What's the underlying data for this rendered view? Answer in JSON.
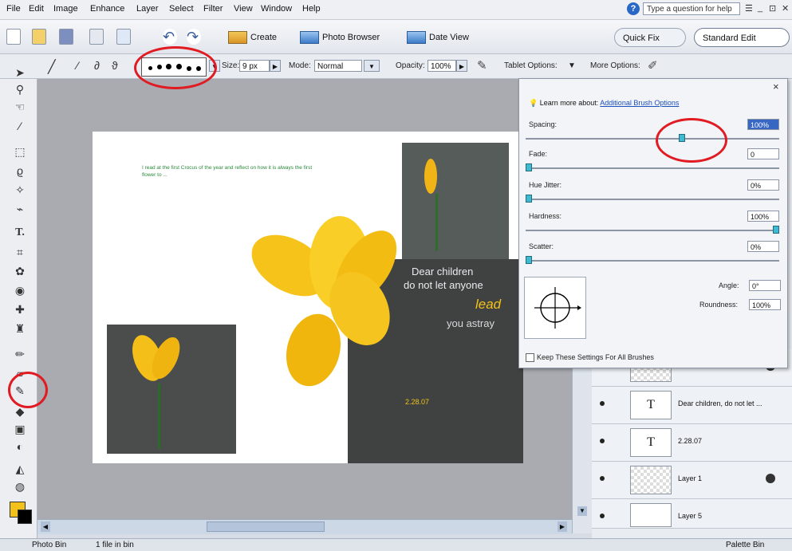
{
  "menu": [
    "File",
    "Edit",
    "Image",
    "Enhance",
    "Layer",
    "Select",
    "Filter",
    "View",
    "Window",
    "Help"
  ],
  "help_box": {
    "placeholder": "Type a question for help"
  },
  "window_controls": [
    "☰",
    "_",
    "⊡",
    "✕"
  ],
  "shortcuts": {
    "create": "Create",
    "photo_browser": "Photo Browser",
    "date_view": "Date View",
    "quick_fix": "Quick Fix",
    "standard_edit": "Standard Edit"
  },
  "options": {
    "size_label": "Size:",
    "size_value": "9 px",
    "mode_label": "Mode:",
    "mode_value": "Normal",
    "opacity_label": "Opacity:",
    "opacity_value": "100%",
    "tablet_label": "Tablet Options:",
    "more_label": "More Options:"
  },
  "brush_options": {
    "learn_prefix": "Learn more about:",
    "learn_link": "Additional Brush Options",
    "spacing_label": "Spacing:",
    "spacing_value": "100%",
    "fade_label": "Fade:",
    "fade_value": "0",
    "hue_label": "Hue Jitter:",
    "hue_value": "0%",
    "hardness_label": "Hardness:",
    "hardness_value": "100%",
    "scatter_label": "Scatter:",
    "scatter_value": "0%",
    "angle_label": "Angle:",
    "angle_value": "0°",
    "roundness_label": "Roundness:",
    "roundness_value": "100%",
    "keep_label": "Keep These Settings For All Brushes",
    "spacing_level": 0.62,
    "fade_level": 0.0,
    "hue_level": 0.0,
    "hardness_level": 1.0,
    "scatter_level": 0.0
  },
  "canvas": {
    "body_text": "I read at the first Crocus of the year and reflect on how it is always the first flower to ...",
    "quote_1": "Dear children",
    "quote_2": "do not let anyone",
    "quote_3": "lead",
    "quote_4": "you astray",
    "date_stamp": "2.28.07"
  },
  "layers": [
    {
      "name": "",
      "thumb": "",
      "checker": true,
      "lock": true
    },
    {
      "name": "Dear children, do not let ...",
      "thumb": "T",
      "checker": false,
      "lock": false
    },
    {
      "name": "2.28.07",
      "thumb": "T",
      "checker": false,
      "lock": false
    },
    {
      "name": "Layer 1",
      "thumb": "",
      "checker": true,
      "lock": true
    },
    {
      "name": "Layer 5",
      "thumb": "",
      "checker": false,
      "lock": false
    }
  ],
  "status": {
    "left": "Photo Bin",
    "files": "1 file in bin",
    "right": "Palette Bin"
  },
  "colors": {
    "accent_blue": "#2a68c7",
    "highlight_red": "#e01b22",
    "crocus_yellow": "#f3c21a"
  }
}
